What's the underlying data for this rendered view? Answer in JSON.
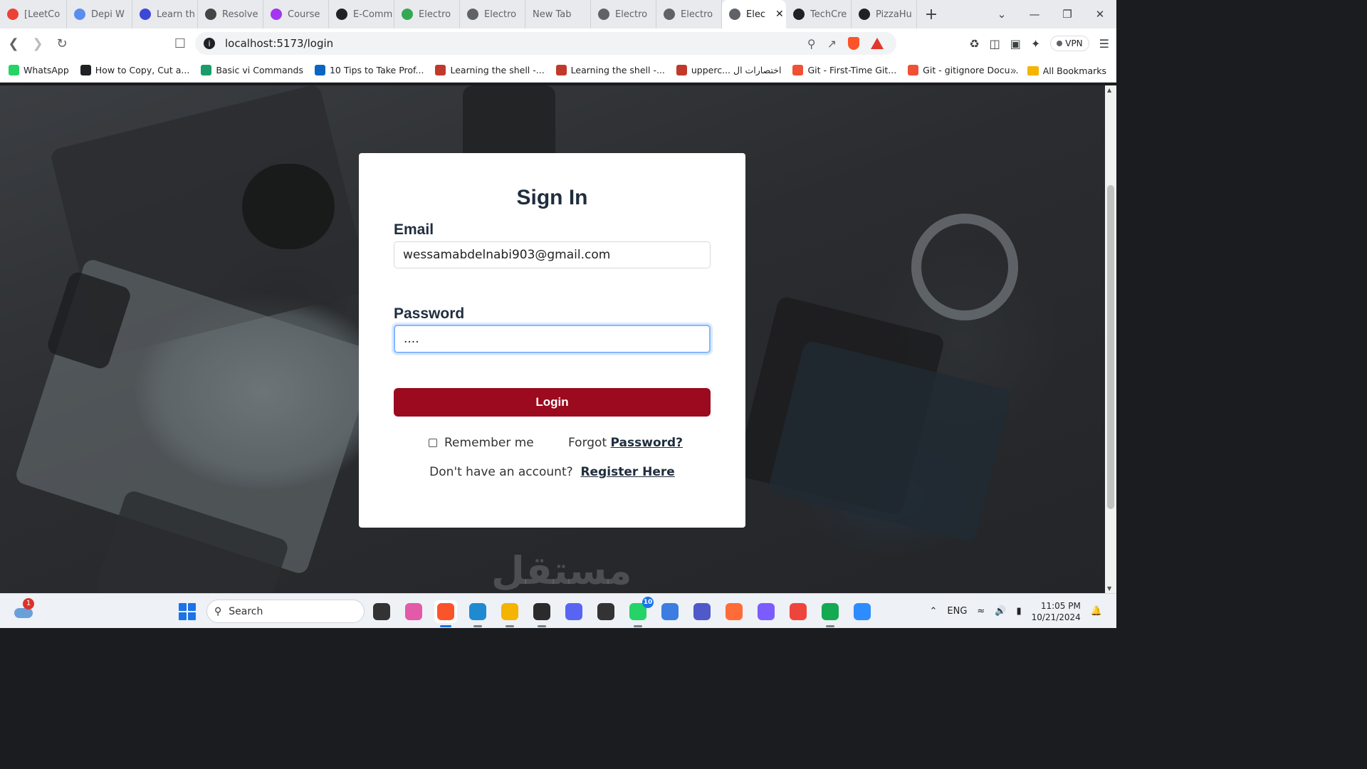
{
  "browser": {
    "tabs": [
      {
        "title": "[LeetCo",
        "icon": "gmail-icon",
        "color": "#ea4335"
      },
      {
        "title": "Depi W",
        "icon": "depi-icon",
        "color": "#5b8def"
      },
      {
        "title": "Learn th",
        "icon": "udemy-icon",
        "color": "#3b48d8"
      },
      {
        "title": "Resolve",
        "icon": "openai-icon",
        "color": "#444"
      },
      {
        "title": "Course",
        "icon": "udemy-course-icon",
        "color": "#a435f0"
      },
      {
        "title": "E-Comm",
        "icon": "github-icon",
        "color": "#202124"
      },
      {
        "title": "Electro",
        "icon": "electro-leaf-icon",
        "color": "#34a853"
      },
      {
        "title": "Electro",
        "icon": "globe-icon",
        "color": "#5f6368"
      },
      {
        "title": "New Tab",
        "icon": "",
        "color": ""
      },
      {
        "title": "Electro",
        "icon": "globe-icon",
        "color": "#5f6368"
      },
      {
        "title": "Electro",
        "icon": "globe-icon",
        "color": "#5f6368"
      },
      {
        "title": "Elec",
        "icon": "globe-icon",
        "color": "#5f6368",
        "active": true
      },
      {
        "title": "TechCre",
        "icon": "github-icon",
        "color": "#202124"
      },
      {
        "title": "PizzaHu",
        "icon": "github-icon",
        "color": "#202124"
      }
    ],
    "new_tab_label": "+",
    "url": "localhost:5173/login",
    "vpn_label": "VPN",
    "bookmarks": [
      {
        "label": "WhatsApp",
        "color": "#25d366"
      },
      {
        "label": "How to Copy, Cut a...",
        "color": "#202124"
      },
      {
        "label": "Basic vi Commands",
        "color": "#1a9c6b"
      },
      {
        "label": "10 Tips to Take Prof...",
        "color": "#0a66c2"
      },
      {
        "label": "Learning the shell -...",
        "color": "#c0392b"
      },
      {
        "label": "Learning the shell -...",
        "color": "#c0392b"
      },
      {
        "label": "upperc... اختصارات ال",
        "color": "#c0392b"
      },
      {
        "label": "Git - First-Time Git...",
        "color": "#f05033"
      },
      {
        "label": "Git - gitignore Docu...",
        "color": "#f05033"
      }
    ],
    "all_bookmarks_label": "All Bookmarks"
  },
  "login": {
    "title": "Sign In",
    "email_label": "Email",
    "email_value": "wessamabdelnabi903@gmail.com",
    "password_label": "Password",
    "password_value": "....",
    "login_button": "Login",
    "remember_label": "Remember me",
    "forgot_prefix": "Forgot",
    "forgot_link": "Password?",
    "register_prefix": "Don't have an account?",
    "register_link": "Register Here"
  },
  "watermark": "مستقل",
  "taskbar": {
    "weather_badge": "1",
    "search_label": "Search",
    "apps": [
      {
        "name": "file-manager-icon",
        "color": "#333"
      },
      {
        "name": "copilot-icon",
        "color": "#e35aa8"
      },
      {
        "name": "brave-browser-icon",
        "color": "#fb542b",
        "active": true
      },
      {
        "name": "vscode-icon",
        "color": "#1f8ad2"
      },
      {
        "name": "file-explorer-icon",
        "color": "#f4b400"
      },
      {
        "name": "terminal-icon",
        "color": "#2b2b2b"
      },
      {
        "name": "discord-icon",
        "color": "#5865f2"
      },
      {
        "name": "unity-icon",
        "color": "#333"
      },
      {
        "name": "whatsapp-icon",
        "color": "#25d366",
        "count": "10"
      },
      {
        "name": "notepad-icon",
        "color": "#3b7de0"
      },
      {
        "name": "teams-icon",
        "color": "#5059c9"
      },
      {
        "name": "postman-icon",
        "color": "#ff6c37"
      },
      {
        "name": "messenger-icon",
        "color": "#7b5cff"
      },
      {
        "name": "anydesk-icon",
        "color": "#ef443b"
      },
      {
        "name": "mongodb-compass-icon",
        "color": "#13aa52"
      },
      {
        "name": "zoom-icon",
        "color": "#2d8cff"
      }
    ],
    "language": "ENG",
    "time": "11:05 PM",
    "date": "10/21/2024"
  }
}
